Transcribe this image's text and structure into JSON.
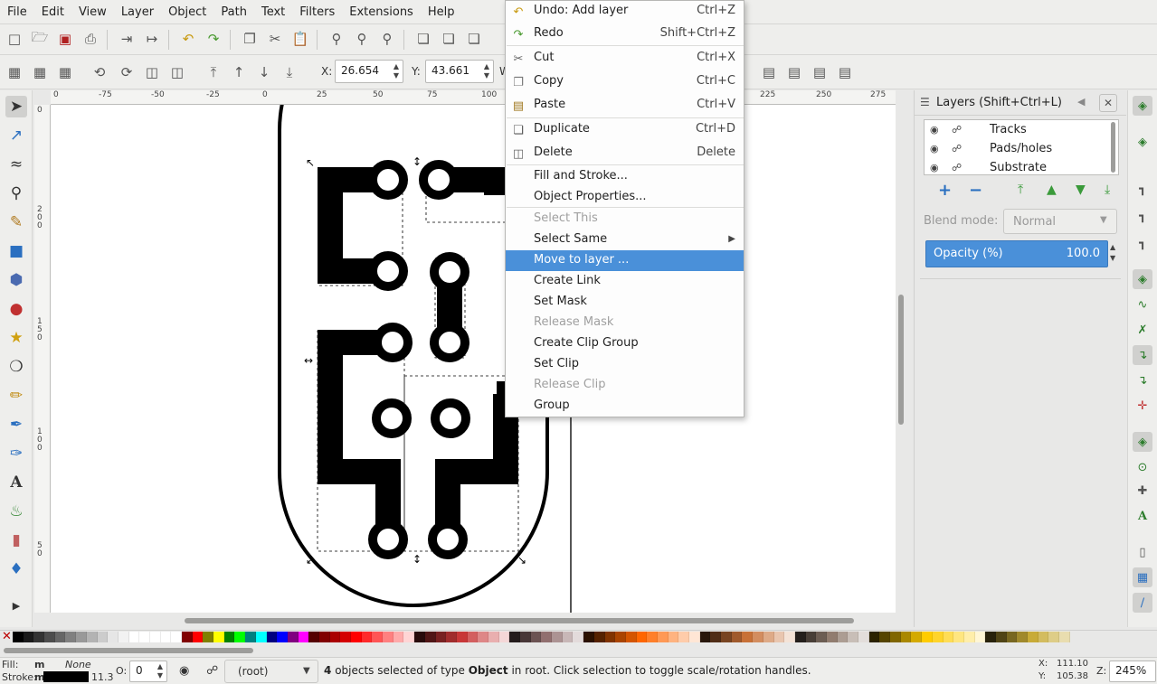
{
  "menubar": {
    "items": [
      "File",
      "Edit",
      "View",
      "Layer",
      "Object",
      "Path",
      "Text",
      "Filters",
      "Extensions",
      "Help"
    ]
  },
  "toolbar": {
    "x_label": "X:",
    "x_value": "26.654",
    "y_label": "Y:",
    "y_value": "43.661",
    "w_label": "W"
  },
  "rulers": {
    "h_labels": [
      "0",
      "-75",
      "-50",
      "-25",
      "0",
      "25",
      "50",
      "75",
      "100",
      "225",
      "250",
      "275"
    ],
    "v_labels": [
      "0",
      "2 0 0",
      "1 5 0",
      "1 0 0",
      "5 0"
    ]
  },
  "context_menu": {
    "items": [
      {
        "label": "Undo: Add layer",
        "shortcut": "Ctrl+Z",
        "icon": "undo-icon"
      },
      {
        "label": "Redo",
        "shortcut": "Shift+Ctrl+Z",
        "icon": "redo-icon"
      },
      {
        "label": "Cut",
        "shortcut": "Ctrl+X",
        "icon": "scissors-icon"
      },
      {
        "label": "Copy",
        "shortcut": "Ctrl+C",
        "icon": "copy-icon"
      },
      {
        "label": "Paste",
        "shortcut": "Ctrl+V",
        "icon": "paste-icon"
      },
      {
        "label": "Duplicate",
        "shortcut": "Ctrl+D",
        "icon": "duplicate-icon"
      },
      {
        "label": "Delete",
        "shortcut": "Delete",
        "icon": "trash-icon"
      },
      {
        "label": "Fill and Stroke..."
      },
      {
        "label": "Object Properties..."
      },
      {
        "label": "Select This"
      },
      {
        "label": "Select Same"
      },
      {
        "label": "Move to layer ..."
      },
      {
        "label": "Create Link"
      },
      {
        "label": "Set Mask"
      },
      {
        "label": "Release Mask"
      },
      {
        "label": "Create Clip Group"
      },
      {
        "label": "Set Clip"
      },
      {
        "label": "Release Clip"
      },
      {
        "label": "Group"
      }
    ]
  },
  "layers_dialog": {
    "title": "Layers (Shift+Ctrl+L)",
    "layers": [
      "Tracks",
      "Pads/holes",
      "Substrate"
    ],
    "blend_label": "Blend mode:",
    "blend_value": "Normal",
    "opacity_label": "Opacity (%)",
    "opacity_value": "100.0"
  },
  "statusbar": {
    "fill_label": "Fill:",
    "fill_value": "m",
    "fill_none": "None",
    "stroke_label": "Stroke:",
    "stroke_value": "m",
    "stroke_width": "11.3",
    "opacity_label": "O:",
    "opacity_value": "0",
    "layer_select": "(root)",
    "message_count": "4",
    "message_a": "objects selected of type",
    "message_type": "Object",
    "message_b": "in root. Click selection to toggle scale/rotation handles.",
    "cursor_x_label": "X:",
    "cursor_x": "111.10",
    "cursor_y_label": "Y:",
    "cursor_y": "105.38",
    "zoom_label": "Z:",
    "zoom_value": "245%"
  },
  "colors": {
    "selection_blue": "#4a90d9",
    "menu_bg": "#fdfdfd",
    "chrome_bg": "#eeeeec"
  },
  "palette": [
    "#000000",
    "#1a1a1a",
    "#333333",
    "#4d4d4d",
    "#666666",
    "#808080",
    "#999999",
    "#b3b3b3",
    "#cccccc",
    "#e6e6e6",
    "#f2f2f2",
    "#ffffff",
    "#ffffff",
    "#ffffff",
    "#ffffff",
    "#ffffff",
    "#800000",
    "#ff0000",
    "#808000",
    "#ffff00",
    "#008000",
    "#00ff00",
    "#008080",
    "#00ffff",
    "#000080",
    "#0000ff",
    "#800080",
    "#ff00ff",
    "#550000",
    "#800000",
    "#aa0000",
    "#d40000",
    "#ff0000",
    "#ff2a2a",
    "#ff5555",
    "#ff8080",
    "#ffaaaa",
    "#ffd5d5",
    "#280b0b",
    "#501616",
    "#782121",
    "#a02c2c",
    "#c83737",
    "#d35f5f",
    "#de8787",
    "#e9afaf",
    "#f4d7d7",
    "#241c1c",
    "#483737",
    "#6c5353",
    "#916f6f",
    "#ac9393",
    "#c8b7b7",
    "#e3dbdb",
    "#2b1100",
    "#552200",
    "#803300",
    "#aa4400",
    "#d45500",
    "#ff6600",
    "#ff7f2a",
    "#ff9955",
    "#ffb380",
    "#ffccaa",
    "#ffe6d5",
    "#28170b",
    "#502d16",
    "#784421",
    "#a05a2c",
    "#c87137",
    "#d38d5f",
    "#deaa87",
    "#e9c6af",
    "#f4e3d7",
    "#241f1c",
    "#483e37",
    "#6c5d53",
    "#917c6f",
    "#ac9d93",
    "#c8beb7",
    "#e3dedb",
    "#2b2200",
    "#554400",
    "#806600",
    "#aa8800",
    "#d4aa00",
    "#ffcc00",
    "#ffd42a",
    "#ffdd55",
    "#ffe680",
    "#ffeeaa",
    "#fff6d5",
    "#28220b",
    "#504416",
    "#786721",
    "#a0892c",
    "#c8ab37",
    "#d3bc5f",
    "#decd87",
    "#e9ddaf"
  ]
}
